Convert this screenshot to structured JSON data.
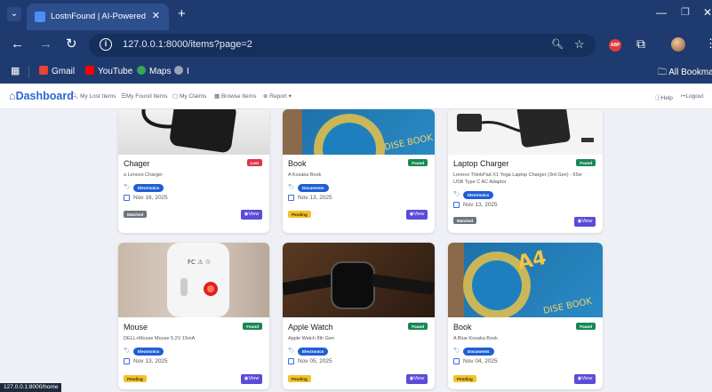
{
  "browser": {
    "tab": {
      "title": "LostnFound | AI-Powered Lo",
      "close_glyph": "✕"
    },
    "new_tab_glyph": "+",
    "url": "127.0.0.1:8000/items?page=2",
    "bookmarks": [
      {
        "label": "Gmail",
        "color": "#ea4335"
      },
      {
        "label": "YouTube",
        "color": "#ff0000"
      },
      {
        "label": "Maps",
        "color": "#34a853"
      },
      {
        "label": "I",
        "color": "#9aa4b8"
      }
    ],
    "all_bookmarks": "All Bookmarks"
  },
  "appnav": {
    "brand": "Dashboard",
    "links": [
      "My Lost Items",
      "My Found Items",
      "My Claims",
      "Browse Items",
      "Report ▾"
    ],
    "help": "Help",
    "logout": "Logout"
  },
  "colors": {
    "accent": "#2f66d1",
    "lost": "#dc3545",
    "found": "#198754",
    "view": "#5b4bd8"
  },
  "items": [
    {
      "title": "Chager",
      "desc": "a Lenovo Charger",
      "type": "Lost",
      "category": "Electronics",
      "date": "Nov 16, 2025",
      "status": "Matched",
      "view": "View"
    },
    {
      "title": "Book",
      "desc": "A Kosaka Book",
      "type": "Found",
      "category": "Documents",
      "date": "Nov 13, 2025",
      "status": "Pending",
      "view": "View"
    },
    {
      "title": "Laptop Charger",
      "desc": "Lenovo ThinkPad X1 Yoga Laptop Charger (3rd Gen) - 65w USB Type C AC Adaptor",
      "type": "Found",
      "category": "Electronics",
      "date": "Nov 13, 2025",
      "status": "Matched",
      "view": "View"
    },
    {
      "title": "Mouse",
      "desc": "DELL+Mouse Mouse 5.2V 15mA",
      "type": "Found",
      "category": "Electronics",
      "date": "Nov 13, 2025",
      "status": "Pending",
      "view": "View"
    },
    {
      "title": "Apple Watch",
      "desc": "Apple Watch 8th Gen",
      "type": "Found",
      "category": "Electronics",
      "date": "Nov 05, 2025",
      "status": "Pending",
      "view": "View"
    },
    {
      "title": "Book",
      "desc": "A Blue Kosaka Book",
      "type": "Found",
      "category": "Documents",
      "date": "Nov 04, 2025",
      "status": "Pending",
      "view": "View"
    }
  ],
  "status_bar_url": "127.0.0.1:8000/home"
}
